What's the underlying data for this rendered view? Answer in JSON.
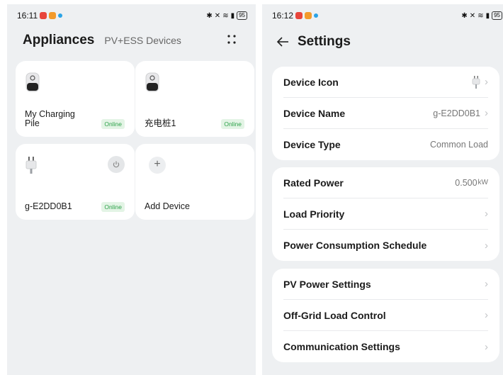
{
  "left_screen": {
    "status": {
      "time": "16:11",
      "battery": "95"
    },
    "header": {
      "title": "Appliances",
      "subtitle": "PV+ESS Devices"
    },
    "devices": [
      {
        "name": "My Charging Pile",
        "status": "Online",
        "icon": "charger-icon"
      },
      {
        "name": "充电桩1",
        "status": "Online",
        "icon": "charger-icon"
      },
      {
        "name": "g-E2DD0B1",
        "status": "Online",
        "icon": "plug-icon"
      }
    ],
    "add_device_label": "Add Device"
  },
  "right_screen": {
    "status": {
      "time": "16:12",
      "battery": "95"
    },
    "header": {
      "title": "Settings"
    },
    "group1": {
      "device_icon_label": "Device Icon",
      "device_name_label": "Device Name",
      "device_name_value": "g-E2DD0B1",
      "device_type_label": "Device Type",
      "device_type_value": "Common Load"
    },
    "group2": {
      "rated_power_label": "Rated Power",
      "rated_power_value": "0.500",
      "rated_power_unit": "kW",
      "load_priority_label": "Load Priority",
      "schedule_label": "Power Consumption Schedule"
    },
    "group3": {
      "pv_label": "PV Power Settings",
      "offgrid_label": "Off-Grid Load Control",
      "comm_label": "Communication Settings"
    }
  },
  "colors": {
    "online_green": "#2ea24b",
    "background": "#eef0f2"
  }
}
